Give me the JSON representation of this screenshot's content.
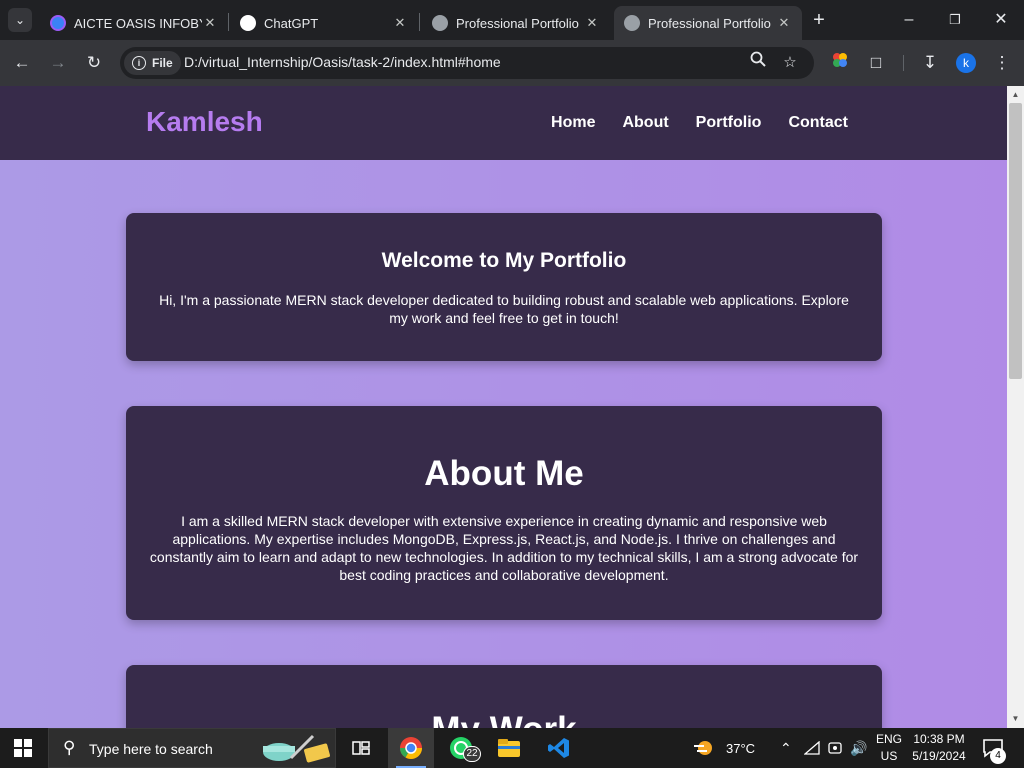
{
  "browser": {
    "tabs": [
      {
        "title": "AICTE OASIS INFOBYTE",
        "favicon_color": "#3b82f6",
        "active": false
      },
      {
        "title": "ChatGPT",
        "favicon_color": "#ffffff",
        "active": false
      },
      {
        "title": "Professional Portfolio",
        "favicon_color": "#9aa0a6",
        "active": false
      },
      {
        "title": "Professional Portfolio",
        "favicon_color": "#9aa0a6",
        "active": true
      }
    ],
    "chip_label": "File",
    "url": "D:/virtual_Internship/Oasis/task-2/index.html#home",
    "profile_initial": "k"
  },
  "site": {
    "logo": "Kamlesh",
    "nav": [
      "Home",
      "About",
      "Portfolio",
      "Contact"
    ],
    "welcome": {
      "title": "Welcome to My Portfolio",
      "text": "Hi, I'm a passionate MERN stack developer dedicated to building robust and scalable web applications. Explore my work and feel free to get in touch!"
    },
    "about": {
      "title": "About Me",
      "text": "I am a skilled MERN stack developer with extensive experience in creating dynamic and responsive web applications. My expertise includes MongoDB, Express.js, React.js, and Node.js. I thrive on challenges and constantly aim to learn and adapt to new technologies. In addition to my technical skills, I am a strong advocate for best coding practices and collaborative development."
    },
    "work": {
      "title": "My Work"
    },
    "colors": {
      "header": "#372b4a",
      "card": "#372b4a",
      "logo": "#b67cf0",
      "bg_start": "#ac9ae6",
      "bg_end": "#b08be6"
    }
  },
  "taskbar": {
    "search_placeholder": "Type here to search",
    "whatsapp_badge": "22",
    "weather": "37°C",
    "lang_line1": "ENG",
    "lang_line2": "US",
    "time": "10:38 PM",
    "date": "5/19/2024",
    "notification_count": "4"
  }
}
